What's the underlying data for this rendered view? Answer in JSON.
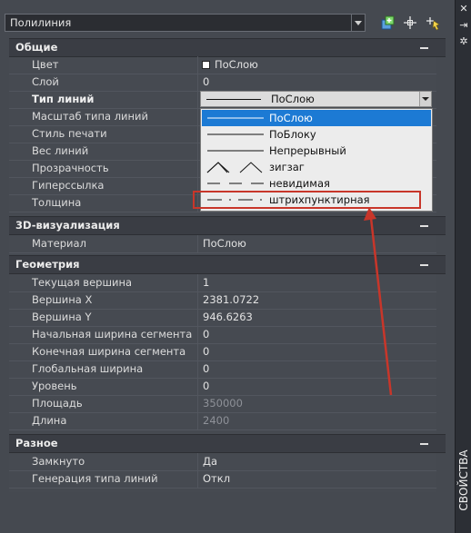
{
  "selector": {
    "value": "Полилиния"
  },
  "rail": {
    "label": "СВОЙСТВА"
  },
  "sections": [
    {
      "title": "Общие",
      "rows": [
        {
          "label": "Цвет",
          "value": "ПоСлою"
        },
        {
          "label": "Слой",
          "value": "0"
        },
        {
          "label": "Тип линий",
          "value": "ПоСлою"
        },
        {
          "label": "Масштаб типа линий",
          "value": ""
        },
        {
          "label": "Стиль печати",
          "value": ""
        },
        {
          "label": "Вес линий",
          "value": ""
        },
        {
          "label": "Прозрачность",
          "value": ""
        },
        {
          "label": "Гиперссылка",
          "value": ""
        },
        {
          "label": "Толщина",
          "value": ""
        }
      ]
    },
    {
      "title": "3D-визуализация",
      "rows": [
        {
          "label": "Материал",
          "value": "ПоСлою"
        }
      ]
    },
    {
      "title": "Геометрия",
      "rows": [
        {
          "label": "Текущая вершина",
          "value": "1"
        },
        {
          "label": "Вершина X",
          "value": "2381.0722"
        },
        {
          "label": "Вершина Y",
          "value": "946.6263"
        },
        {
          "label": "Начальная ширина сегмента",
          "value": "0"
        },
        {
          "label": "Конечная ширина сегмента",
          "value": "0"
        },
        {
          "label": "Глобальная ширина",
          "value": "0"
        },
        {
          "label": "Уровень",
          "value": "0"
        },
        {
          "label": "Площадь",
          "value": "350000"
        },
        {
          "label": "Длина",
          "value": "2400"
        }
      ]
    },
    {
      "title": "Разное",
      "rows": [
        {
          "label": "Замкнуто",
          "value": "Да"
        },
        {
          "label": "Генерация типа линий",
          "value": "Откл"
        }
      ]
    }
  ],
  "linetype_dropdown": {
    "options": [
      "ПоСлою",
      "ПоБлоку",
      "Непрерывный",
      "зигзаг",
      "невидимая",
      "штрихпунктирная"
    ],
    "selected": "ПоСлою"
  },
  "colors": {
    "selection": "#1c7ad4",
    "annotation": "#c8362a"
  }
}
